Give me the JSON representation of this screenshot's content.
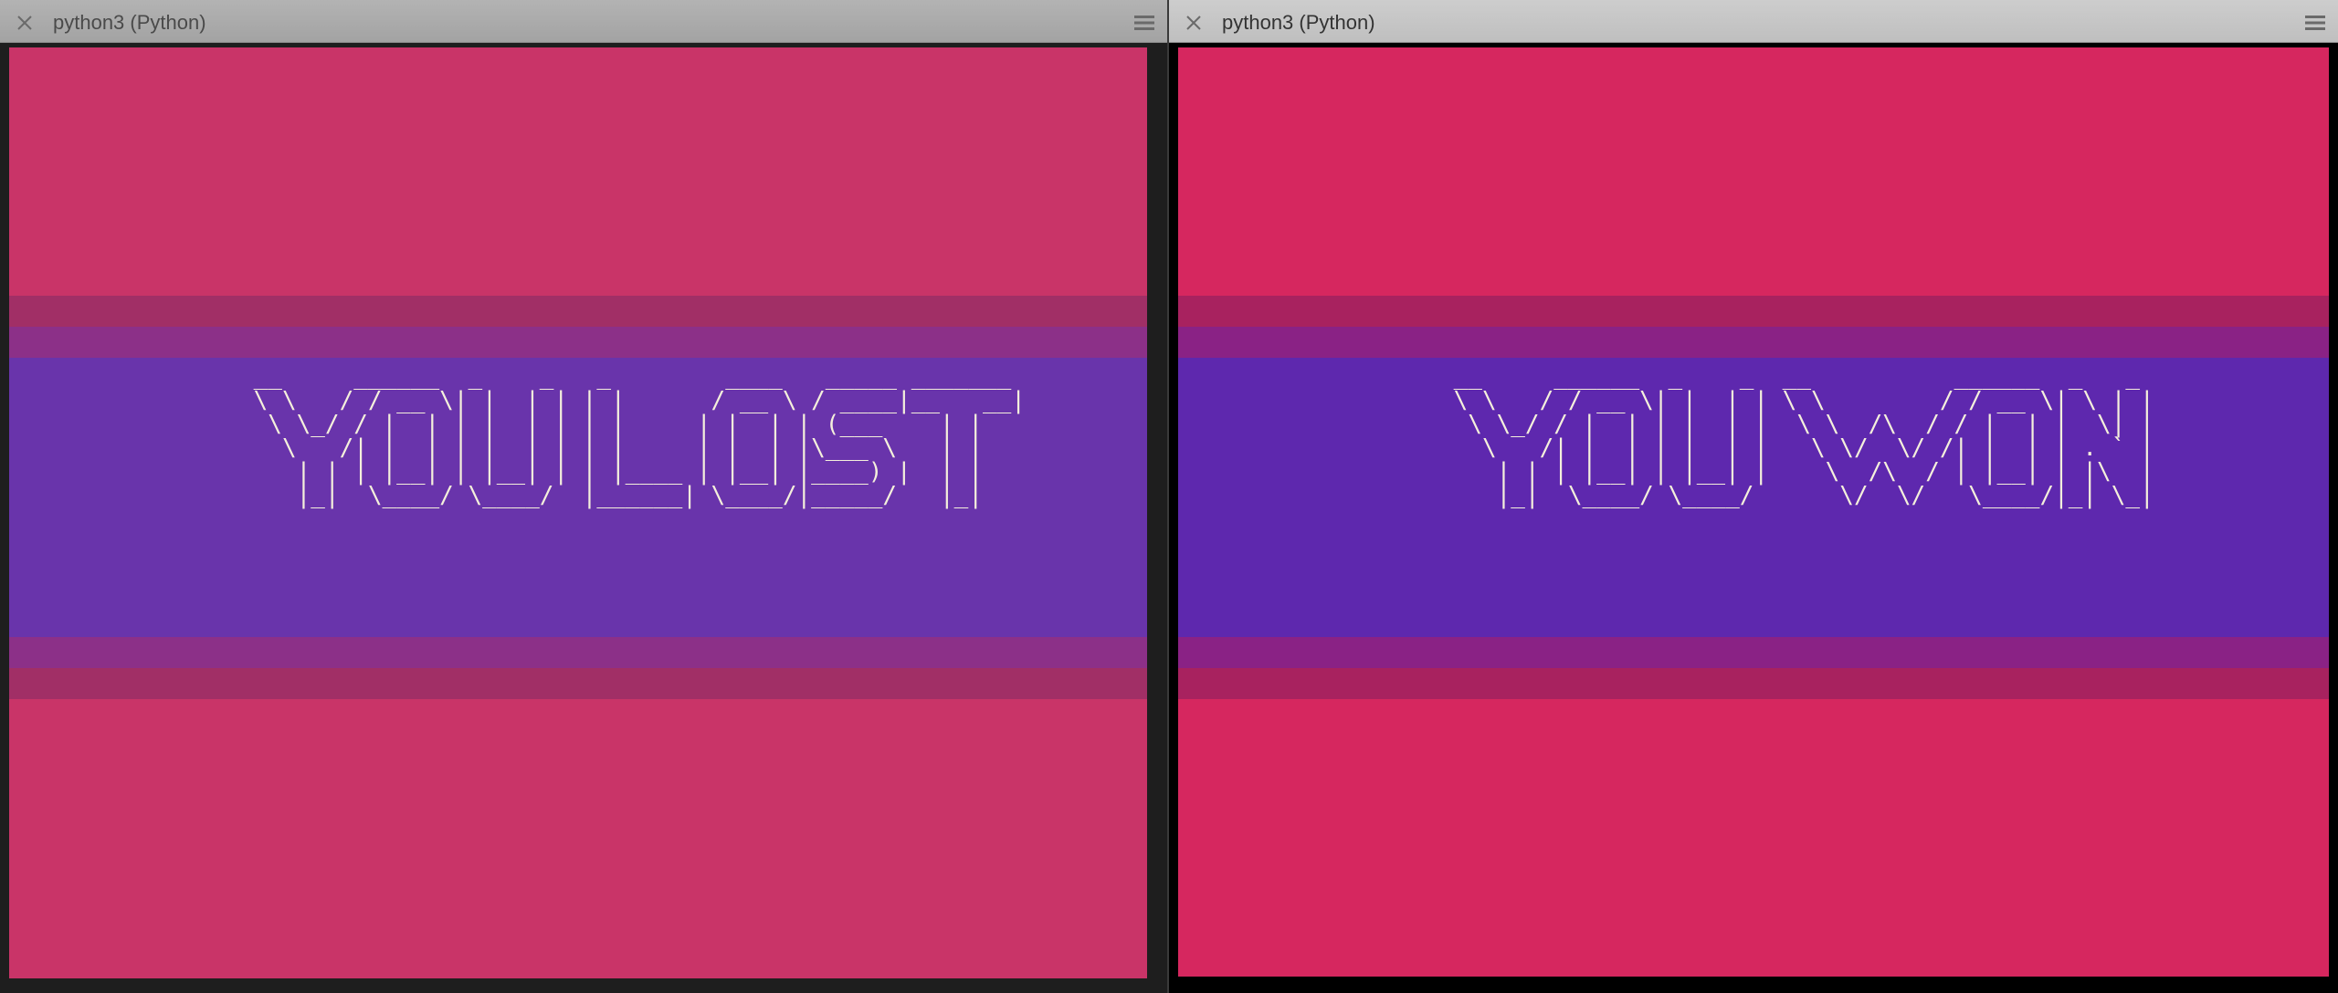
{
  "left_window": {
    "tab_title": "python3 (Python)",
    "colors": {
      "pink": "#c93468",
      "dark_stripe": "#a12f66",
      "mid_stripe": "#8c3088",
      "purple": "#6934ab"
    },
    "message_art": [
      " __     ______  _    _   _        ____   _____ _______ ",
      " \\ \\   / / __ \\| |  | | | |      / __ \\ / ____|__   __|",
      "  \\ \\_/ / |  | | |  | | | |     | |  | | (___    | |   ",
      "   \\   /| |  | | |  | | | |     | |  | |\\___ \\   | |   ",
      "    | | | |__| | |__| | | |____ | |__| |____) |  | |   ",
      "    |_|  \\____/ \\____/  |______| \\____/|_____/   |_|   "
    ]
  },
  "right_window": {
    "tab_title": "python3 (Python)",
    "colors": {
      "pink": "#d6275f",
      "dark_stripe": "#a8225f",
      "mid_stripe": "#8a2285",
      "purple": "#5e28ae"
    },
    "message_art": [
      " __     ______  _    _  __          ______  _   _ ",
      " \\ \\   / / __ \\| |  | | \\ \\        / / __ \\| \\ | |",
      "  \\ \\_/ / |  | | |  | |  \\ \\  /\\  / / |  | |  \\| |",
      "   \\   /| |  | | |  | |   \\ \\/  \\/ /| |  | | . ` |",
      "    | | | |__| | |__| |    \\  /\\  / | |__| | |\\  |",
      "    |_|  \\____/ \\____/      \\/  \\/   \\____/|_| \\_|"
    ]
  }
}
